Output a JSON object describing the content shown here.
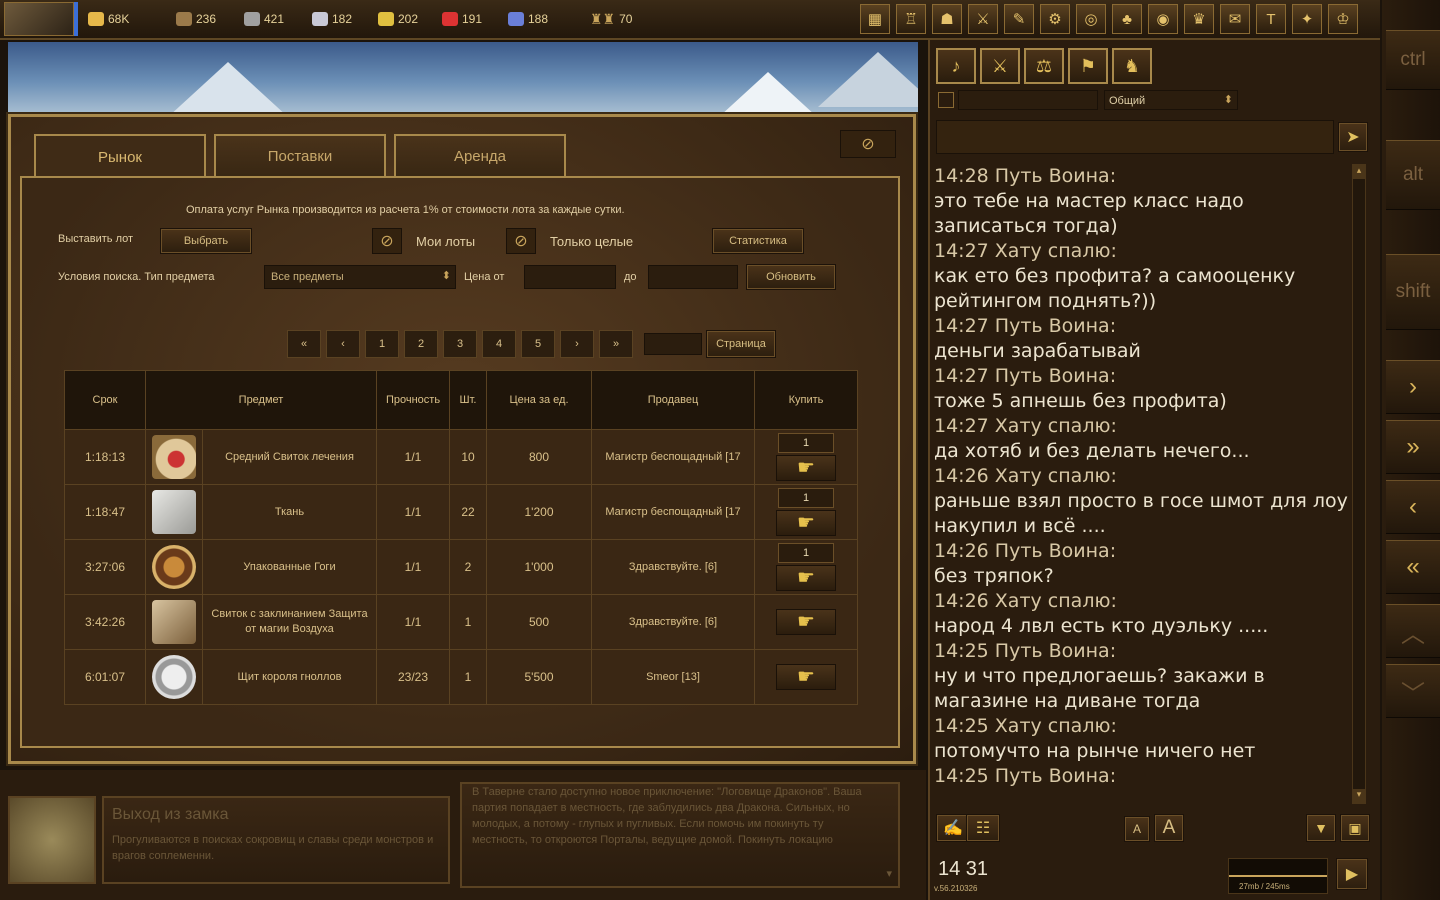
{
  "topbar": {
    "resources": [
      {
        "icon": "gold-icon",
        "value": "68K",
        "color": "#e6b84a"
      },
      {
        "icon": "wood-icon",
        "value": "236",
        "color": "#9b7a4a"
      },
      {
        "icon": "ore-icon",
        "value": "421",
        "color": "#a0a0a0"
      },
      {
        "icon": "mercury-icon",
        "value": "182",
        "color": "#c9c9d6"
      },
      {
        "icon": "sulfur-icon",
        "value": "202",
        "color": "#e0c040"
      },
      {
        "icon": "crystal-icon",
        "value": "191",
        "color": "#d33"
      },
      {
        "icon": "gems-icon",
        "value": "188",
        "color": "#6a7fd8"
      }
    ],
    "population": "70"
  },
  "sidekeys": {
    "ctrl": "ctrl",
    "alt": "alt",
    "shift": "shift"
  },
  "market": {
    "tabs": [
      "Рынок",
      "Поставки",
      "Аренда"
    ],
    "notice": "Оплата услуг Рынка производится из расчета 1% от стоимости лота за каждые сутки.",
    "list_lot_label": "Выставить лот",
    "choose_button": "Выбрать",
    "my_lots_label": "Мои лоты",
    "only_whole_label": "Только целые",
    "stats_button": "Статистика",
    "search_label": "Условия поиска. Тип предмета",
    "item_type_value": "Все предметы",
    "price_from_label": "Цена от",
    "price_to_label": "до",
    "refresh_button": "Обновить",
    "pagination": [
      "«",
      "‹",
      "1",
      "2",
      "3",
      "4",
      "5",
      "›",
      "»"
    ],
    "page_button": "Страница",
    "columns": [
      "Срок",
      "Предмет",
      "Прочность",
      "Шт.",
      "Цена за ед.",
      "Продавец",
      "Купить"
    ],
    "rows": [
      {
        "time": "1:18:13",
        "item": "Средний Свиток лечения",
        "durability": "1/1",
        "qty": "10",
        "price": "800",
        "seller": "Магистр беспощадный [17",
        "buy_qty": "1"
      },
      {
        "time": "1:18:47",
        "item": "Ткань",
        "durability": "1/1",
        "qty": "22",
        "price": "1'200",
        "seller": "Магистр беспощадный [17",
        "buy_qty": "1"
      },
      {
        "time": "3:27:06",
        "item": "Упакованные Гоги",
        "durability": "1/1",
        "qty": "2",
        "price": "1'000",
        "seller": "Здравствуйте. [6]",
        "buy_qty": "1"
      },
      {
        "time": "3:42:26",
        "item": "Свиток с заклинанием Защита от магии Воздуха",
        "durability": "1/1",
        "qty": "1",
        "price": "500",
        "seller": "Здравствуйте. [6]",
        "buy_qty": ""
      },
      {
        "time": "6:01:07",
        "item": "Щит короля гноллов",
        "durability": "23/23",
        "qty": "1",
        "price": "5'500",
        "seller": "Smeor [13]",
        "buy_qty": ""
      }
    ]
  },
  "bottom": {
    "exit_title": "Выход из замка",
    "exit_desc": "Прогуливаются в поисках сокровищ и славы среди монстров и врагов соплеменни.",
    "news_text": "В Таверне стало доступно новое приключение: \"Логовище Драконов\". Ваша партия попадает в местность, где заблудились два Дракона. Сильных, но молодых, а потому - глупых и пугливых. Если помочь им покинуть ту местность, то откроются Порталы, ведущие домой. Покинуть локацию"
  },
  "chat": {
    "channel": "Общий",
    "messages": [
      {
        "time": "14:28 Путь Воина:",
        "text": "это тебе на мастер класс надо записаться тогда)"
      },
      {
        "time": "14:27 Хату спалю:",
        "text": "как ето без профита? а самооценку рейтингом поднять?))"
      },
      {
        "time": "14:27 Путь Воина:",
        "text": "деньги зарабатывай"
      },
      {
        "time": "14:27 Путь Воина:",
        "text": "тоже 5 апнешь без профита)"
      },
      {
        "time": "14:27 Хату спалю:",
        "text": "да хотяб и без делать нечего..."
      },
      {
        "time": "14:26 Хату спалю:",
        "text": "раньше взял просто в госе шмот для лоу накупил и всё ...."
      },
      {
        "time": "14:26 Путь Воина:",
        "text": "без тряпок?"
      },
      {
        "time": "14:26 Хату спалю:",
        "text": "народ 4 лвл есть кто дуэльку ....."
      },
      {
        "time": "14:25 Путь Воина:",
        "text": "ну и что предлогаешь? закажи в магазине на диване тогда"
      },
      {
        "time": "14:25 Хату спалю:",
        "text": "потомучто на рынче ничего нет"
      },
      {
        "time": "14:25 Путь Воина:",
        "text": ""
      }
    ],
    "clock": "14 31",
    "version": "v.56.210326",
    "traffic": "27mb / 245ms"
  }
}
